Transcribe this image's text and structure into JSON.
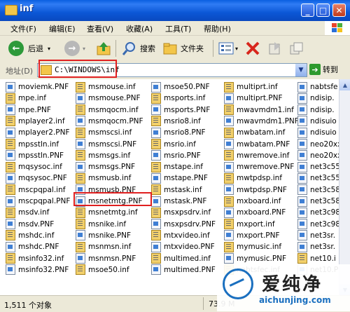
{
  "window": {
    "title": "inf",
    "min": "_",
    "max": "□",
    "close": "✕"
  },
  "menu": [
    "文件(F)",
    "编辑(E)",
    "查看(V)",
    "收藏(A)",
    "工具(T)",
    "帮助(H)"
  ],
  "toolbar": {
    "back": "后退",
    "search": "搜索",
    "folders": "文件夹"
  },
  "address": {
    "label": "地址(D)",
    "path": "C:\\WINDOWS\\inf",
    "go": "转到"
  },
  "files": {
    "col1": [
      "moviemk.PNF",
      "mpe.inf",
      "mpe.PNF",
      "mplayer2.inf",
      "mplayer2.PNF",
      "mpsstln.inf",
      "mpsstln.PNF",
      "mqsysoc.inf",
      "mqsysoc.PNF",
      "mscpqpal.inf",
      "mscpqpal.PNF",
      "msdv.inf",
      "msdv.PNF",
      "mshdc.inf",
      "mshdc.PNF",
      "msinfo32.inf",
      "msinfo32.PNF"
    ],
    "col2": [
      "msmouse.inf",
      "msmouse.PNF",
      "msmqocm.inf",
      "msmqocm.PNF",
      "msmscsi.inf",
      "msmscsi.PNF",
      "msmsgs.inf",
      "msmsgs.PNF",
      "msmusb.inf",
      "msmusb.PNF",
      "msnetmtg.PNF",
      "msnetmtg.inf",
      "msnike.inf",
      "msnike.PNF",
      "msnmsn.inf",
      "msnmsn.PNF",
      "msoe50.inf"
    ],
    "col3": [
      "msoe50.PNF",
      "msports.inf",
      "msports.PNF",
      "msrio8.inf",
      "msrio8.PNF",
      "msrio.inf",
      "msrio.PNF",
      "mstape.inf",
      "mstape.PNF",
      "mstask.inf",
      "mstask.PNF",
      "msxpsdrv.inf",
      "msxpsdrv.PNF",
      "mtxvideo.inf",
      "mtxvideo.PNF",
      "multimed.inf",
      "multimed.PNF"
    ],
    "col4": [
      "multiprt.inf",
      "multiprt.PNF",
      "mwavmdm1.inf",
      "mwavmdm1.PNF",
      "mwbatam.inf",
      "mwbatam.PNF",
      "mwremove.inf",
      "mwremove.PNF",
      "mwtpdsp.inf",
      "mwtpdsp.PNF",
      "mxboard.inf",
      "mxboard.PNF",
      "mxport.inf",
      "mxport.PNF",
      "mymusic.inf",
      "mymusic.PNF",
      "nabtsfec.inf"
    ],
    "col5": [
      "nabtsfe",
      "ndisip.",
      "ndisip.",
      "ndisuio",
      "ndisuio",
      "neo20xx",
      "neo20xx",
      "net3c55",
      "net3c55",
      "net3c58",
      "net3c58",
      "net3c98",
      "net3c98",
      "net3sr.",
      "net3sr.",
      "net10.i",
      "net10.P"
    ]
  },
  "status": {
    "count": "1,511 个对象",
    "size": "73.9 M"
  },
  "watermark": {
    "brand": "爱纯净",
    "url": "aichunjing.com"
  }
}
